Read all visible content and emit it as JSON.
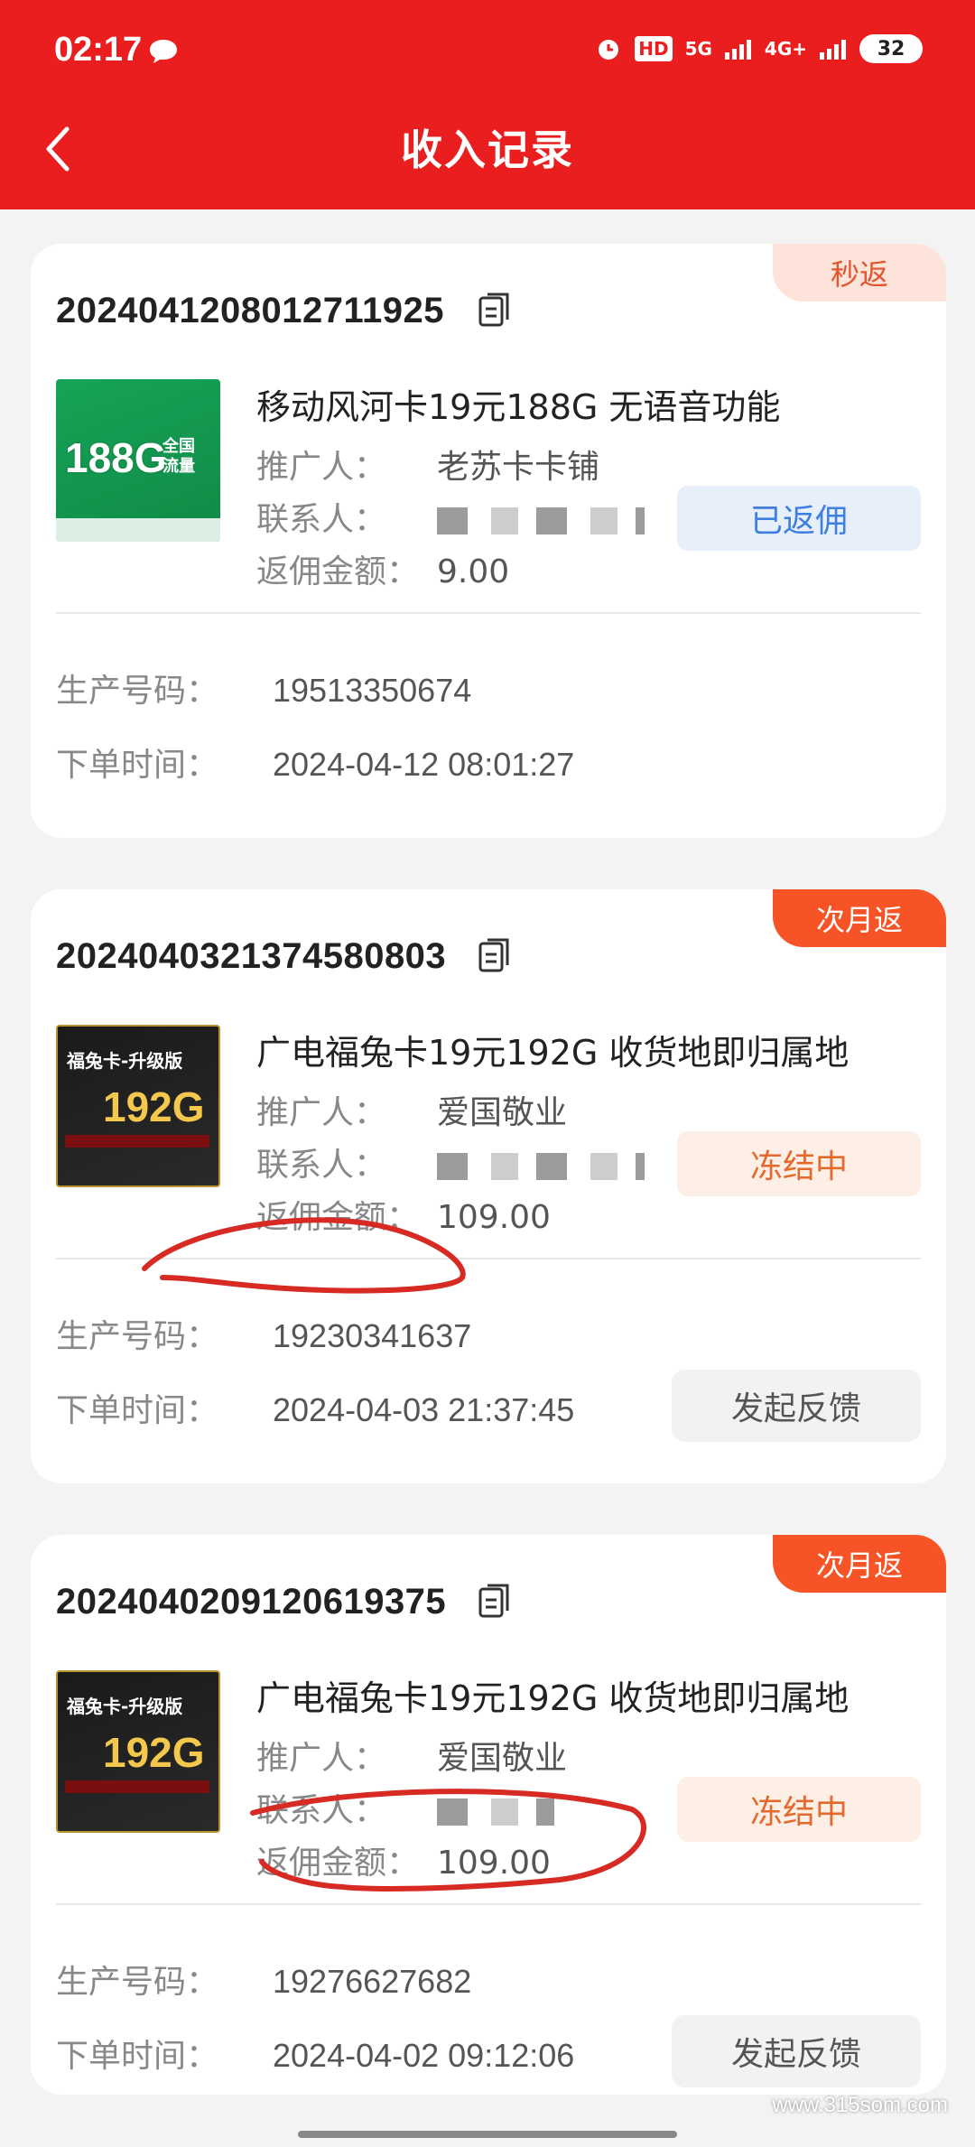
{
  "status_bar": {
    "time": "02:17",
    "hd": "HD",
    "net1": "5G",
    "net2": "4G+",
    "battery": "32"
  },
  "header": {
    "title": "收入记录"
  },
  "labels": {
    "promoter": "推广人：",
    "contact": "联系人：",
    "commission": "返佣金额：",
    "production_no": "生产号码：",
    "order_time": "下单时间："
  },
  "orders": [
    {
      "tag": "秒返",
      "order_no": "2024041208012711925",
      "product": "移动风河卡19元188G 无语音功能",
      "thumb_big": "188G",
      "thumb_side": "全国流量",
      "promoter": "老苏卡卡铺",
      "commission": "9.00",
      "status": "已返佣",
      "production_no": "19513350674",
      "order_time": "2024-04-12 08:01:27"
    },
    {
      "tag": "次月返",
      "order_no": "2024040321374580803",
      "product": "广电福兔卡19元192G 收货地即归属地",
      "thumb_top": "福兔卡-升级版",
      "thumb_big": "192G",
      "promoter": "爱国敬业",
      "commission": "109.00",
      "status": "冻结中",
      "production_no": "19230341637",
      "order_time": "2024-04-03 21:37:45",
      "action": "发起反馈"
    },
    {
      "tag": "次月返",
      "order_no": "2024040209120619375",
      "product": "广电福兔卡19元192G 收货地即归属地",
      "thumb_top": "福兔卡-升级版",
      "thumb_big": "192G",
      "promoter": "爱国敬业",
      "commission": "109.00",
      "status": "冻结中",
      "production_no": "19276627682",
      "order_time": "2024-04-02 09:12:06",
      "action": "发起反馈"
    }
  ],
  "watermark": "www.315som.com",
  "colors": {
    "header": "#ea1e1e",
    "tag_strong": "#f65427",
    "tag_light": "#fde3d9",
    "annotation": "#d62a22"
  }
}
